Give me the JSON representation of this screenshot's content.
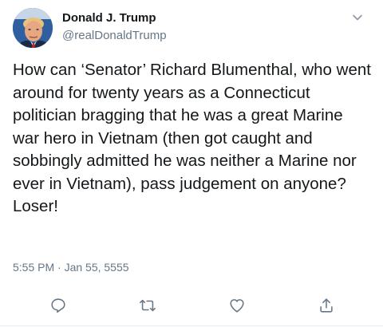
{
  "author": {
    "display_name": "Donald J. Trump",
    "handle": "@realDonaldTrump"
  },
  "tweet": {
    "text": "How can ‘Senator’ Richard Blumenthal, who went around for twenty years as a Connecticut politician bragging that he was a great Marine war hero in Vietnam (then got caught and sobbingly admitted he was neither a Marine nor ever in Vietnam), pass judgement on anyone? Loser!",
    "timestamp": "5:55 PM · Jan 55, 5555"
  },
  "icons": {
    "avatar": "profile-photo",
    "menu": "chevron-down-icon",
    "reply": "reply-icon",
    "retweet": "retweet-icon",
    "like": "heart-icon",
    "share": "share-icon"
  },
  "colors": {
    "text": "#14171a",
    "secondary": "#657786",
    "icon": "#657786"
  }
}
